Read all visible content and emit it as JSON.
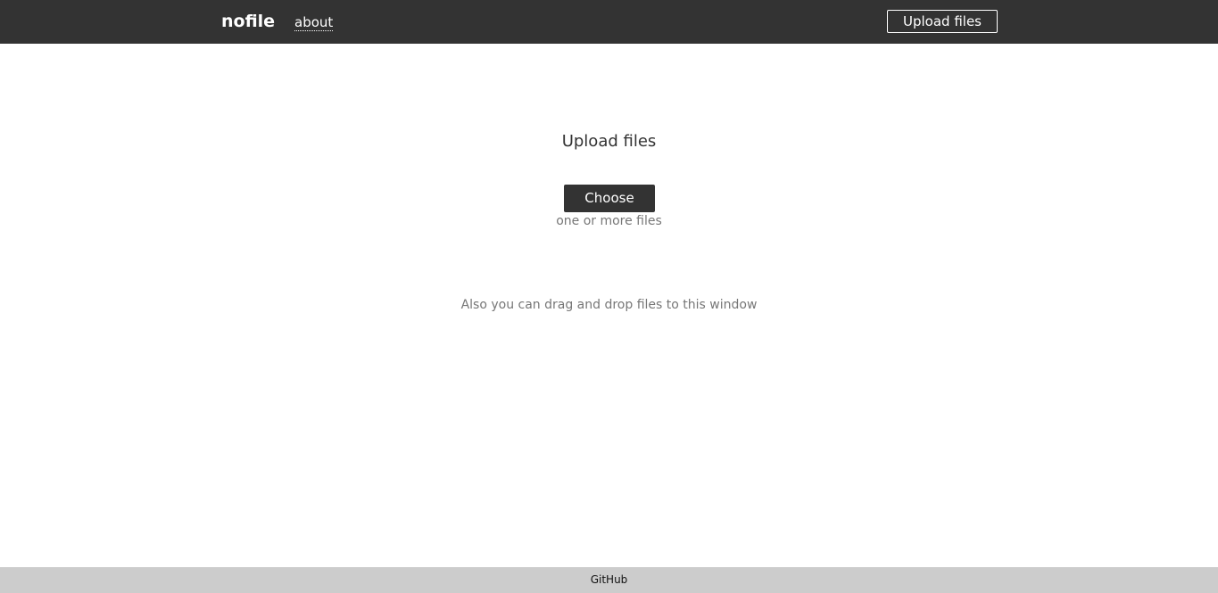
{
  "header": {
    "brand": "nofile",
    "about_link": "about",
    "upload_button": "Upload files"
  },
  "main": {
    "title": "Upload files",
    "choose_button": "Choose",
    "choose_hint": "one or more files",
    "drag_drop_hint": "Also you can drag and drop files to this window"
  },
  "footer": {
    "github_link": "GitHub"
  },
  "colors": {
    "header_bg": "#333333",
    "footer_bg": "#cccccc",
    "button_bg": "#333333",
    "hint_text": "#777777"
  }
}
